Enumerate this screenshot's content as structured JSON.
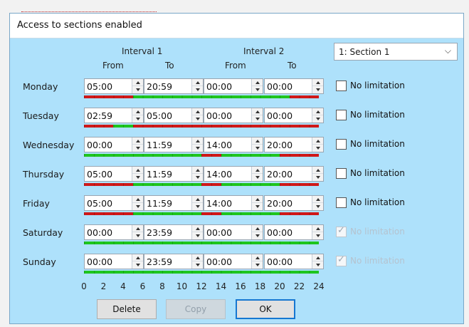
{
  "dialog": {
    "title": "Access to sections enabled"
  },
  "headers": {
    "interval1": "Interval 1",
    "interval2": "Interval 2",
    "from": "From",
    "to": "To"
  },
  "section_select": {
    "value": "1: Section 1"
  },
  "no_limit_label": "No limitation",
  "days": [
    {
      "label": "Monday",
      "i1_from": "05:00",
      "i1_to": "20:59",
      "i2_from": "00:00",
      "i2_to": "00:00",
      "no_limit": false,
      "green": [
        [
          5,
          21
        ]
      ]
    },
    {
      "label": "Tuesday",
      "i1_from": "02:59",
      "i1_to": "05:00",
      "i2_from": "00:00",
      "i2_to": "00:00",
      "no_limit": false,
      "green": [
        [
          3,
          5
        ]
      ]
    },
    {
      "label": "Wednesday",
      "i1_from": "00:00",
      "i1_to": "11:59",
      "i2_from": "14:00",
      "i2_to": "20:00",
      "no_limit": false,
      "green": [
        [
          0,
          12
        ],
        [
          14,
          20
        ]
      ]
    },
    {
      "label": "Thursday",
      "i1_from": "05:00",
      "i1_to": "11:59",
      "i2_from": "14:00",
      "i2_to": "20:00",
      "no_limit": false,
      "green": [
        [
          5,
          12
        ],
        [
          14,
          20
        ]
      ]
    },
    {
      "label": "Friday",
      "i1_from": "05:00",
      "i1_to": "11:59",
      "i2_from": "14:00",
      "i2_to": "20:00",
      "no_limit": false,
      "green": [
        [
          5,
          12
        ],
        [
          14,
          20
        ]
      ]
    },
    {
      "label": "Saturday",
      "i1_from": "00:00",
      "i1_to": "23:59",
      "i2_from": "00:00",
      "i2_to": "00:00",
      "no_limit": true,
      "green": [
        [
          0,
          24
        ]
      ]
    },
    {
      "label": "Sunday",
      "i1_from": "00:00",
      "i1_to": "23:59",
      "i2_from": "00:00",
      "i2_to": "00:00",
      "no_limit": true,
      "green": [
        [
          0,
          24
        ]
      ]
    }
  ],
  "scale": [
    "0",
    "2",
    "4",
    "6",
    "8",
    "10",
    "12",
    "14",
    "16",
    "18",
    "20",
    "22",
    "24"
  ],
  "buttons": {
    "delete": "Delete",
    "copy": "Copy",
    "ok": "OK"
  },
  "colors": {
    "background": "#aee1fb",
    "allowed": "#1ec51e",
    "denied": "#d01818"
  }
}
